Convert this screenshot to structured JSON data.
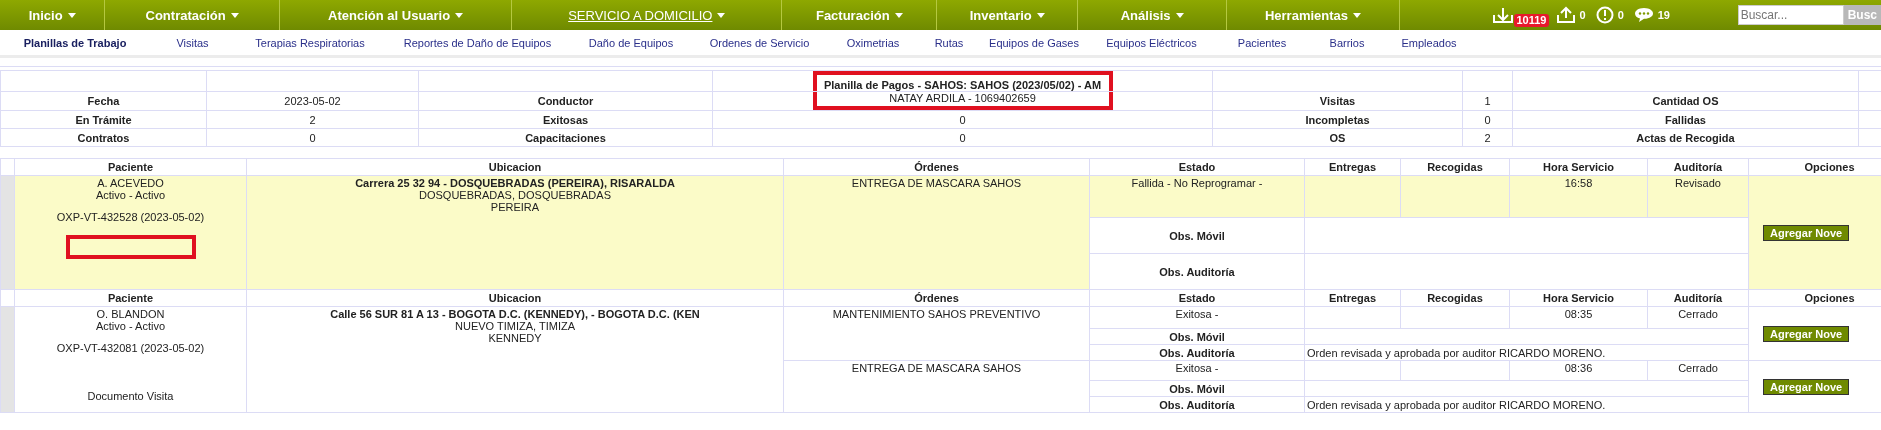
{
  "nav": {
    "menus": [
      {
        "label": "Inicio",
        "selected": false
      },
      {
        "label": "Contratación",
        "selected": false
      },
      {
        "label": "Atención al Usuario",
        "selected": false
      },
      {
        "label": "SERVICIO A DOMICILIO",
        "selected": true
      },
      {
        "label": "Facturación",
        "selected": false
      },
      {
        "label": "Inventario",
        "selected": false
      },
      {
        "label": "Análisis",
        "selected": false
      },
      {
        "label": "Herramientas",
        "selected": false
      }
    ],
    "mail_badge": "10119",
    "uploads": "0",
    "alerts": "0",
    "messages": "19",
    "search": {
      "placeholder": "Buscar...",
      "button": "Busc"
    }
  },
  "submenu": [
    {
      "label": "Planillas de Trabajo",
      "selected": true
    },
    {
      "label": "Visitas",
      "selected": false
    },
    {
      "label": "Terapias Respiratorias",
      "selected": false
    },
    {
      "label": "Reportes de Daño de Equipos",
      "selected": false
    },
    {
      "label": "Daño de Equipos",
      "selected": false
    },
    {
      "label": "Ordenes de Servicio",
      "selected": false
    },
    {
      "label": "Oximetrias",
      "selected": false
    },
    {
      "label": "Rutas",
      "selected": false
    },
    {
      "label": "Equipos de Gases",
      "selected": false
    },
    {
      "label": "Equipos Eléctricos",
      "selected": false
    },
    {
      "label": "Pacientes",
      "selected": false
    },
    {
      "label": "Barrios",
      "selected": false
    },
    {
      "label": "Empleados",
      "selected": false
    }
  ],
  "summary": {
    "title": "Planilla de Pagos - SAHOS: SAHOS (2023/05/02) - AM",
    "highlighted": true,
    "rows": [
      [
        "Fecha",
        "2023-05-02",
        "Conductor",
        "NATAY ARDILA - 1069402659",
        "Visitas",
        "1",
        "Cantidad OS"
      ],
      [
        "En Trámite",
        "2",
        "Exitosas",
        "0",
        "Incompletas",
        "0",
        "Fallidas"
      ],
      [
        "Contratos",
        "0",
        "Capacitaciones",
        "0",
        "OS",
        "2",
        "Actas de Recogida"
      ]
    ]
  },
  "visits": [
    {
      "highlighted": true,
      "marked": true,
      "columns": [
        "Paciente",
        "Ubicacion",
        "Órdenes",
        "Estado",
        "Entregas",
        "Recogidas",
        "Hora Servicio",
        "Auditoría",
        "Opciones"
      ],
      "patient": "A. ACEVEDO",
      "status": "Activo - Activo",
      "code": "OXP-VT-432528 (2023-05-02)",
      "address": "Carrera 25 32 94 - DOSQUEBRADAS (PEREIRA), RISARALDA",
      "area": "DOSQUEBRADAS, DOSQUEBRADAS",
      "city": "PEREIRA",
      "orders": [
        {
          "order": "ENTREGA DE MASCARA SAHOS",
          "state": "Fallida - No Reprogramar -",
          "time": "16:58",
          "audit": "Revisado",
          "mobile_label": "Obs. Móvil",
          "audit_label": "Obs. Auditoría",
          "button": "Agregar Nove"
        }
      ]
    },
    {
      "highlighted": false,
      "marked": false,
      "columns": [
        "Paciente",
        "Ubicacion",
        "Órdenes",
        "Estado",
        "Entregas",
        "Recogidas",
        "Hora Servicio",
        "Auditoría",
        "Opciones"
      ],
      "patient": "O. BLANDON",
      "status": "Activo - Activo",
      "code": "OXP-VT-432081 (2023-05-02)",
      "document": "Documento Visita",
      "address": "Calle 56 SUR 81 A 13 - BOGOTA D.C. (KENNEDY), - BOGOTA D.C. (KEN",
      "area": "NUEVO TIMIZA, TIMIZA",
      "city": "KENNEDY",
      "orders": [
        {
          "order": "MANTENIMIENTO SAHOS PREVENTIVO",
          "state": "Exitosa -",
          "time": "08:35",
          "audit": "Cerrado",
          "mobile_label": "Obs. Móvil",
          "audit_label": "Obs. Auditoría",
          "audit_note": "Orden revisada y aprobada por auditor RICARDO MORENO.",
          "button": "Agregar Nove"
        },
        {
          "order": "ENTREGA DE MASCARA SAHOS",
          "state": "Exitosa -",
          "time": "08:36",
          "audit": "Cerrado",
          "mobile_label": "Obs. Móvil",
          "audit_label": "Obs. Auditoría",
          "audit_note": "Orden revisada y aprobada por auditor RICARDO MORENO.",
          "button": "Agregar Nove"
        }
      ]
    }
  ]
}
